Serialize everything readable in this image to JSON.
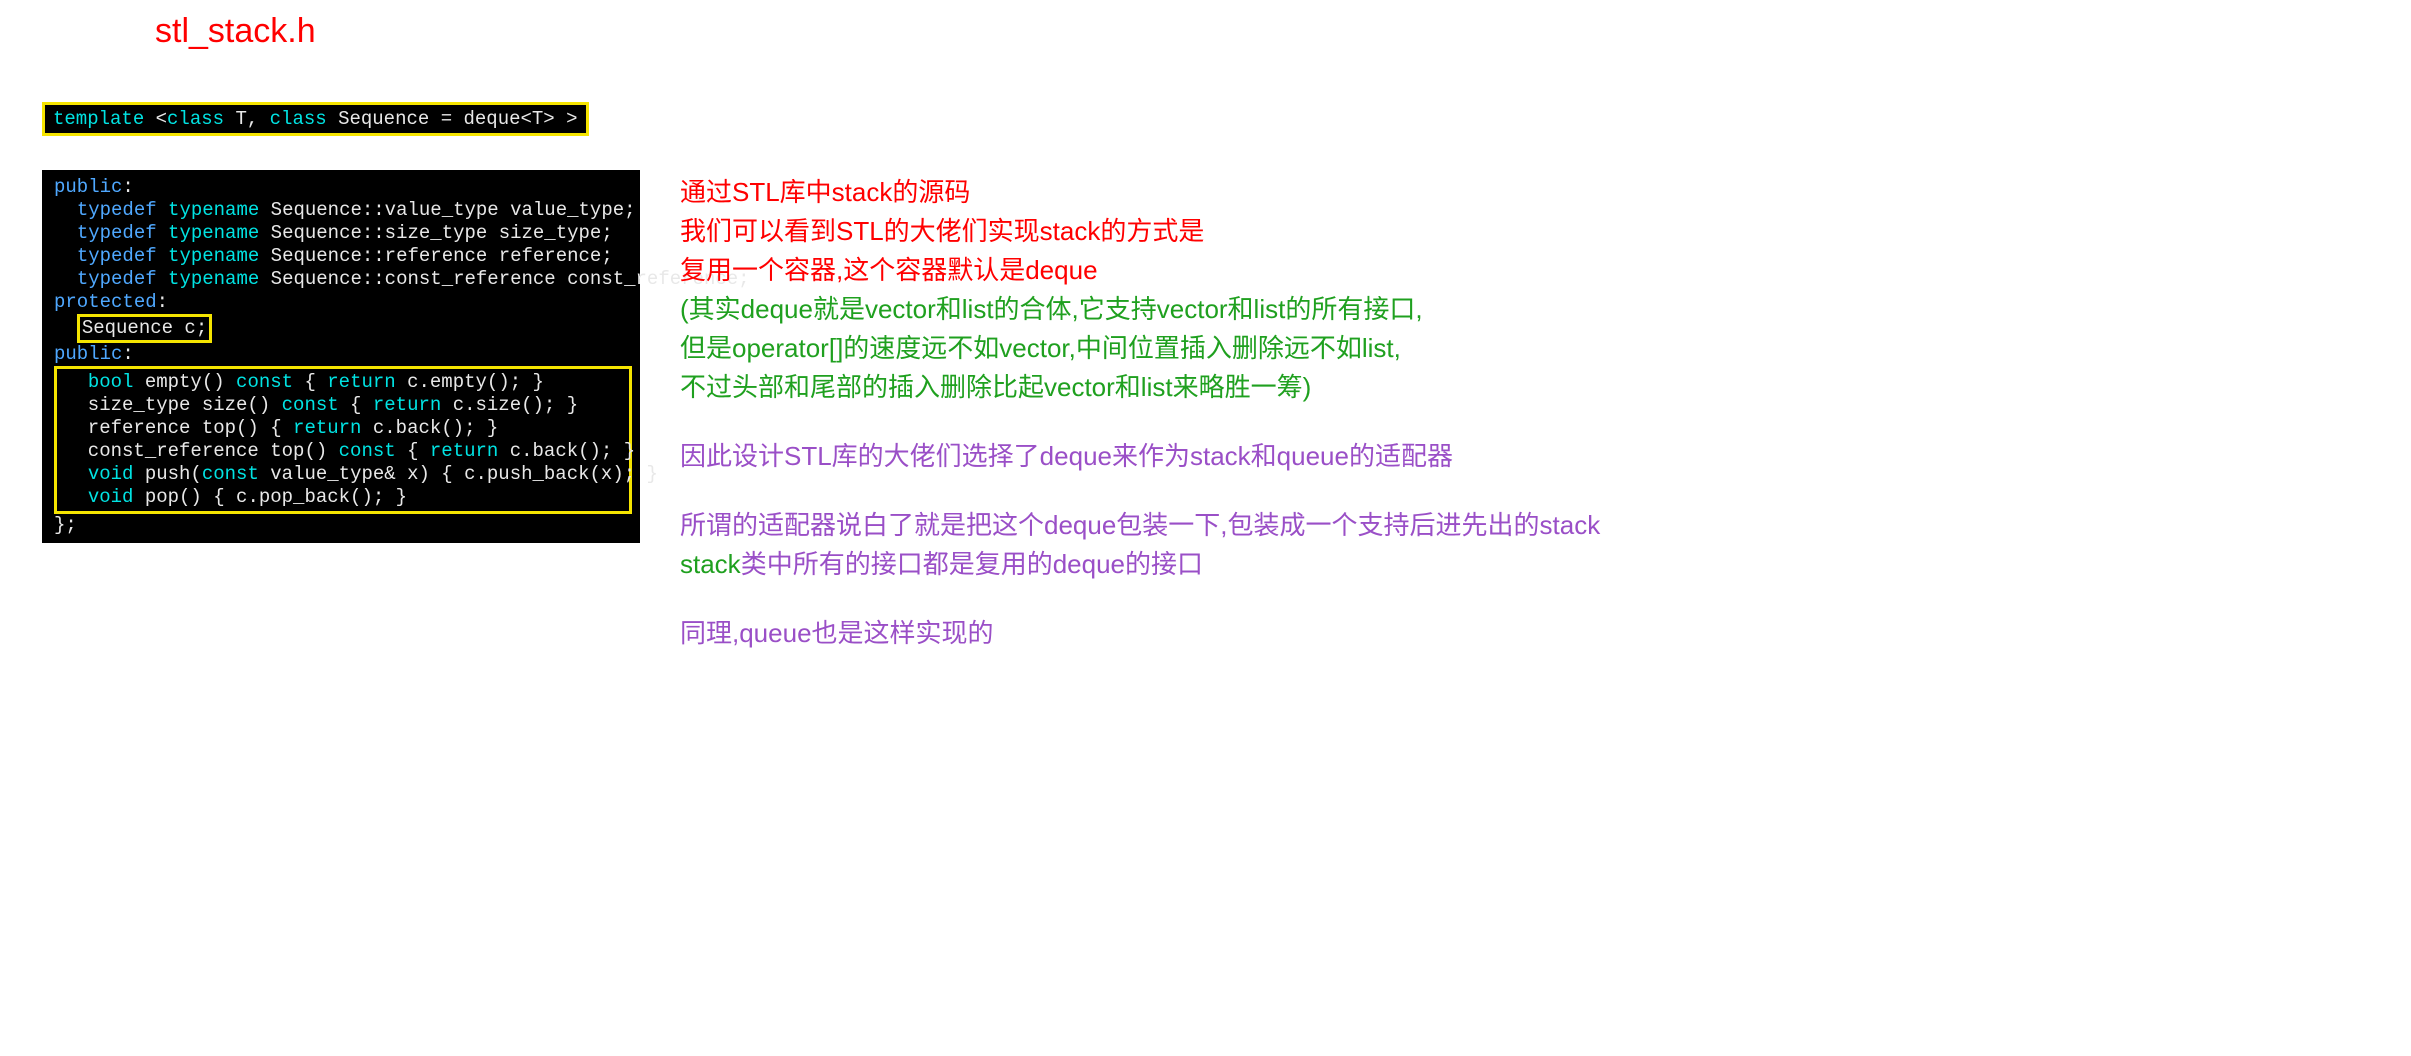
{
  "title": "stl_stack.h",
  "code1": {
    "template_kw": "template",
    "open": " <",
    "class1": "class",
    "t": " T, ",
    "class2": "class",
    "seq": " Sequence = deque<T> >"
  },
  "code2": {
    "public1": "public",
    "colon": ":",
    "typedef": "typedef",
    "typename": "typename",
    "l1": " Sequence::value_type value_type;",
    "l2": " Sequence::size_type size_type;",
    "l3": " Sequence::reference reference;",
    "l4": " Sequence::const_reference const_reference;",
    "protected": "protected",
    "seqc": "Sequence c;",
    "public2": "public",
    "bool": "bool",
    "const": "const",
    "return": "return",
    "void": "void",
    "empty_sig": " empty() ",
    "empty_body": " c.empty(); }",
    "size_sig": "  size_type size() ",
    "size_body": " c.size(); }",
    "top1_sig": "  reference top() { ",
    "top1_body": " c.back(); }",
    "top2_sig": "  const_reference top() ",
    "top2_body": " c.back(); }",
    "push_sig": " push(",
    "push_arg": " value_type& x) { c.push_back(x); }",
    "pop_sig": " pop() { c.pop_back(); }",
    "brace_open": " { ",
    "closing": "};"
  },
  "notes": {
    "r1": "通过STL库中stack的源码",
    "r2": "我们可以看到STL的大佬们实现stack的方式是",
    "r3": "复用一个容器,这个容器默认是deque",
    "g1": "(其实deque就是vector和list的合体,它支持vector和list的所有接口,",
    "g2": "但是operator[]的速度远不如vector,中间位置插入删除远不如list,",
    "g3": "不过头部和尾部的插入删除比起vector和list来略胜一筹)",
    "p1": "因此设计STL库的大佬们选择了deque来作为stack和queue的适配器",
    "p2a": "所谓的适配器说白了就是把这个deque包装一下,包装成一个支持后进先出的stack",
    "p2b_green": "stack",
    "p2b_rest": "类中所有的接口都是复用的deque的接口",
    "p3": "同理,queue也是这样实现的"
  }
}
